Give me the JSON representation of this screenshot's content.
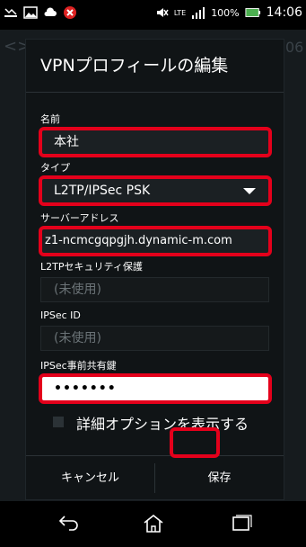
{
  "status_bar": {
    "battery": "100%",
    "network": "LTE",
    "time": "14:06"
  },
  "background": {
    "arrow": "<>",
    "partial_text": "06"
  },
  "dialog": {
    "title": "VPNプロフィールの編集",
    "fields": {
      "name": {
        "label": "名前",
        "value": "本社"
      },
      "type": {
        "label": "タイプ",
        "value": "L2TP/IPSec PSK"
      },
      "server": {
        "label": "サーバーアドレス",
        "value": "z1-ncmcgqpgjh.dynamic-m.com"
      },
      "l2tp_secret": {
        "label": "L2TPセキュリティ保護",
        "value": "(未使用)"
      },
      "ipsec_id": {
        "label": "IPSec ID",
        "value": "(未使用)"
      },
      "ipsec_psk": {
        "label": "IPSec事前共有鍵",
        "value": "•••••••"
      }
    },
    "advanced_checkbox_label": "詳細オプションを表示する",
    "buttons": {
      "cancel": "キャンセル",
      "save": "保存"
    }
  },
  "colors": {
    "highlight": "#e4001b",
    "dialog_bg": "#101416"
  },
  "icons": [
    "missed-call-icon",
    "picture-icon",
    "cloud-icon",
    "alert-icon",
    "mute-icon",
    "signal-icon",
    "battery-icon",
    "back-icon",
    "home-icon",
    "recent-apps-icon"
  ]
}
